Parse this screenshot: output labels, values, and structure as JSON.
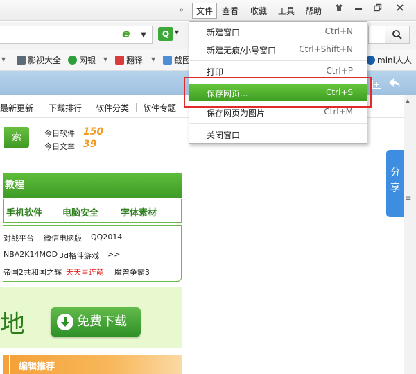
{
  "menubar": {
    "overflow": "»",
    "menus": [
      "文件",
      "查看",
      "收藏",
      "工具",
      "帮助"
    ],
    "window_buttons": [
      "skin",
      "minimize",
      "restore",
      "close"
    ]
  },
  "address_bar": {
    "dropdown_icon": "chevron-down-icon",
    "search_engine_letter": "Q",
    "search_icon": "search-icon"
  },
  "favorites": [
    {
      "label": "影视大全"
    },
    {
      "label": "网银"
    },
    {
      "label": "翻译"
    },
    {
      "label": "截图"
    },
    {
      "label": "mini人人"
    }
  ],
  "page_nav": [
    "最新更新",
    "下载排行",
    "软件分类",
    "软件专题"
  ],
  "search": {
    "button_label": "索"
  },
  "stats": [
    {
      "label": "今日软件",
      "value": "150"
    },
    {
      "label": "今日文章",
      "value": "39"
    }
  ],
  "panel": {
    "title": "教程",
    "categories": [
      "手机软件",
      "电脑安全",
      "字体素材"
    ],
    "tags": [
      [
        "对战平台",
        "微信电脑版",
        "QQ2014"
      ],
      [
        "NBA2K14MOD",
        "3d格斗游戏",
        ">>"
      ],
      [
        "帝国2共和国之辉",
        "天天星连萌",
        "魔兽争霸3"
      ]
    ]
  },
  "download": {
    "partial_text": "地",
    "button_label": "免费下载"
  },
  "editor_bar": {
    "label": "编辑推荐"
  },
  "share": {
    "label_1": "分",
    "label_2": "享",
    "handle": "≡"
  },
  "file_menu": {
    "items": [
      {
        "label": "新建窗口",
        "shortcut": "Ctrl+N"
      },
      {
        "label": "新建无痕/小号窗口",
        "shortcut": "Ctrl+Shift+N"
      },
      {
        "label": "打印",
        "shortcut": "Ctrl+P"
      },
      {
        "label": "保存网页...",
        "shortcut": "Ctrl+S",
        "highlighted": true
      },
      {
        "label": "保存网页为图片",
        "shortcut": "Ctrl+M"
      },
      {
        "label": "关闭窗口",
        "shortcut": ""
      }
    ]
  },
  "colors": {
    "accent_green": "#4aa52e",
    "highlight_red": "#e02b2b",
    "stat_orange": "#f39a1e",
    "share_blue": "#3d8ee0"
  }
}
